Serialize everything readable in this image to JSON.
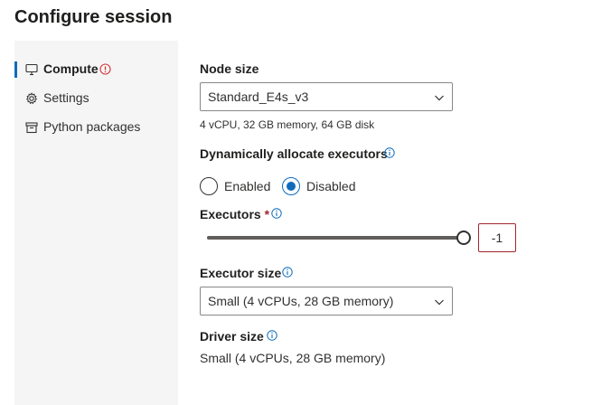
{
  "page": {
    "title": "Configure session"
  },
  "sidebar": {
    "items": [
      {
        "label": "Compute",
        "icon": "monitor-icon",
        "active": true,
        "has_error": true
      },
      {
        "label": "Settings",
        "icon": "gear-icon",
        "active": false
      },
      {
        "label": "Python packages",
        "icon": "package-icon",
        "active": false
      }
    ],
    "error_color": "#d13438",
    "accent": "#0f6cbd"
  },
  "form": {
    "node_size": {
      "label": "Node size",
      "value": "Standard_E4s_v3",
      "hint": "4 vCPU, 32 GB memory, 64 GB disk"
    },
    "dynamic_alloc": {
      "label": "Dynamically allocate executors",
      "options": [
        {
          "label": "Enabled",
          "checked": false
        },
        {
          "label": "Disabled",
          "checked": true
        }
      ]
    },
    "executors": {
      "label": "Executors",
      "required_mark": "*",
      "slider_fraction": 1.0,
      "value": "-1"
    },
    "executor_size": {
      "label": "Executor size",
      "value": "Small (4 vCPUs, 28 GB memory)"
    },
    "driver_size": {
      "label": "Driver size",
      "value": "Small (4 vCPUs, 28 GB memory)"
    }
  }
}
